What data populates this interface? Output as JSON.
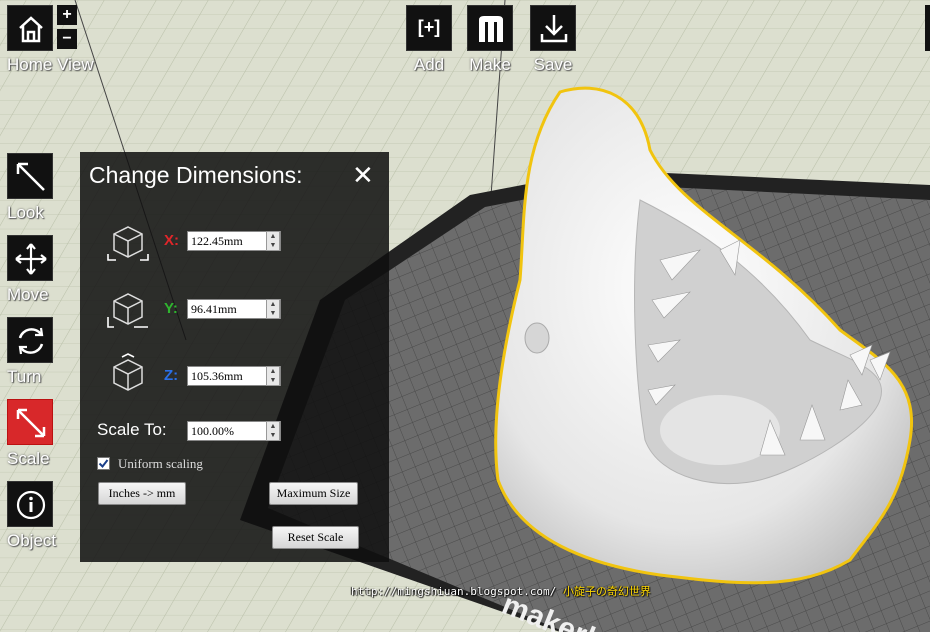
{
  "toolbar_top_left": {
    "home_label": "Home View",
    "zoom_in": "+",
    "zoom_out": "−"
  },
  "toolbar_top": {
    "add_label": "Add",
    "add_icon_text": "[+]",
    "make_label": "Make",
    "save_label": "Save"
  },
  "sidebar": {
    "items": [
      {
        "label": "Look",
        "icon": "look-arrow-icon"
      },
      {
        "label": "Move",
        "icon": "move-arrows-icon"
      },
      {
        "label": "Turn",
        "icon": "turn-rotate-icon"
      },
      {
        "label": "Scale",
        "icon": "scale-arrow-icon"
      },
      {
        "label": "Object",
        "icon": "info-icon"
      }
    ],
    "active_color": "#d8282a"
  },
  "dimensions_panel": {
    "title": "Change Dimensions:",
    "close": "✕",
    "x": {
      "label": "X:",
      "value": "122.45mm",
      "color": "#e0262a"
    },
    "y": {
      "label": "Y:",
      "value": "96.41mm",
      "color": "#2fb52f"
    },
    "z": {
      "label": "Z:",
      "value": "105.36mm",
      "color": "#2a6fe8"
    },
    "scale_to_label": "Scale To:",
    "scale_value": "100.00%",
    "uniform_scaling_label": "Uniform scaling",
    "uniform_scaling_checked": true,
    "inches_button": "Inches -> mm",
    "max_size_button": "Maximum Size",
    "reset_scale_button": "Reset Scale"
  },
  "build_plate_text": "makerb",
  "watermark": {
    "url": "http://mingshiuan.blogspot.com/",
    "cjk": "小旋子の奇幻世界"
  },
  "colors": {
    "selection_outline": "#f1c40f",
    "grid_background": "#d9dccb",
    "plate": "#5a5a5a"
  }
}
